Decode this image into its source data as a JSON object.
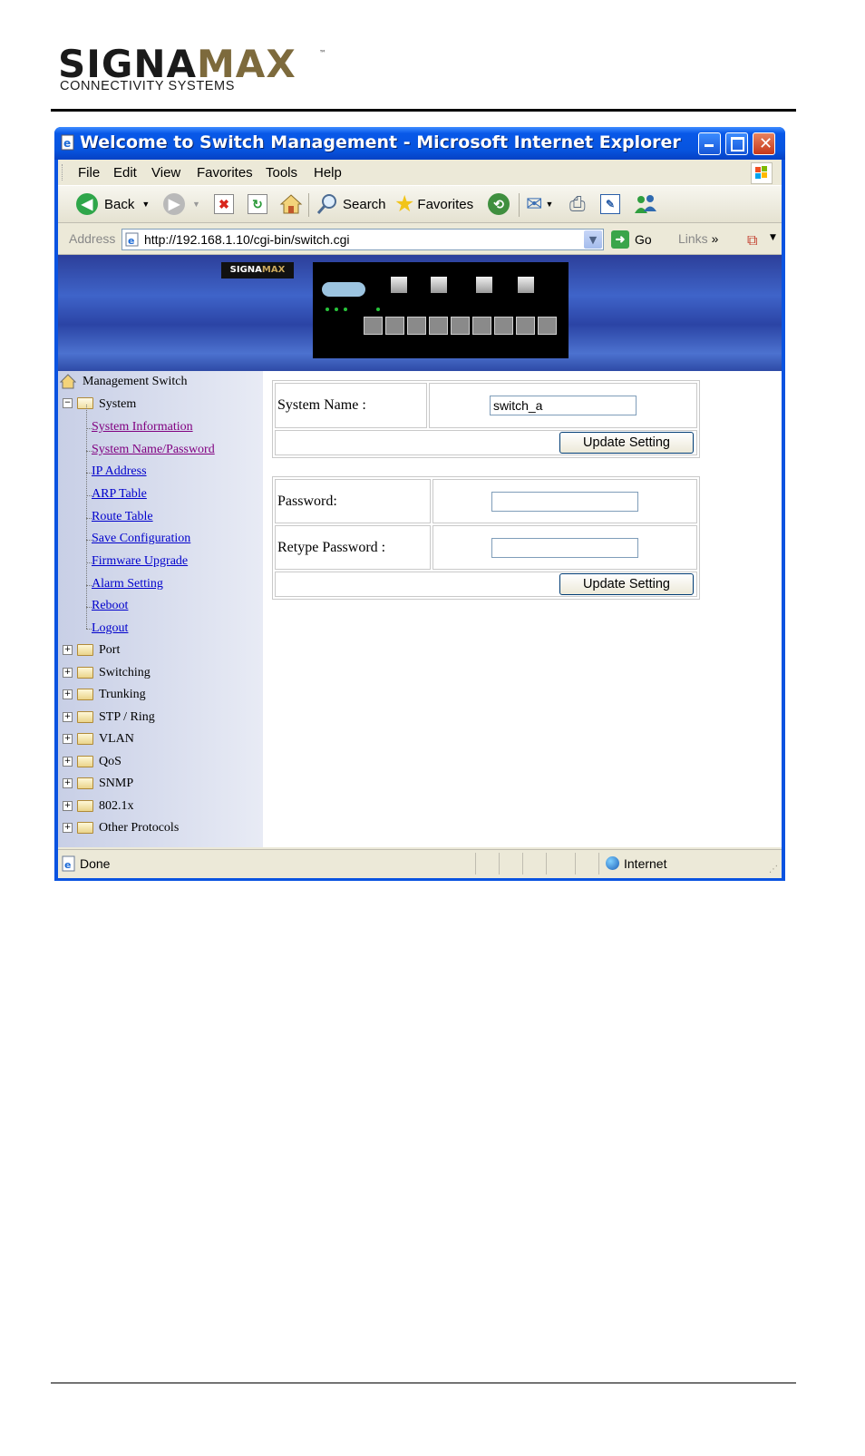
{
  "brand": {
    "name_left": "SIGNA",
    "name_right": "MAX",
    "trademark": "™",
    "tagline": "CONNECTIVITY SYSTEMS"
  },
  "window": {
    "title": "Welcome to Switch Management - Microsoft Internet Explorer"
  },
  "menu": [
    {
      "label": "File",
      "key": "F"
    },
    {
      "label": "Edit",
      "key": "E"
    },
    {
      "label": "View",
      "key": "V"
    },
    {
      "label": "Favorites",
      "key": "a"
    },
    {
      "label": "Tools",
      "key": "T"
    },
    {
      "label": "Help",
      "key": "H"
    }
  ],
  "toolbar": {
    "back": "Back",
    "search": "Search",
    "favorites": "Favorites"
  },
  "address": {
    "label": "Address",
    "url": "http://192.168.1.10/cgi-bin/switch.cgi",
    "go": "Go",
    "links": "Links",
    "more": "»"
  },
  "banner": {
    "logo_left": "SIGNA",
    "logo_right": "MAX"
  },
  "nav": {
    "root": "Management Switch",
    "system": "System",
    "system_links": [
      "System Information",
      "System Name/Password",
      "IP Address",
      "ARP Table",
      "Route Table",
      "Save Configuration",
      "Firmware Upgrade",
      "Alarm Setting",
      "Reboot",
      "Logout"
    ],
    "folders": [
      "Port",
      "Switching",
      "Trunking",
      "STP / Ring",
      "VLAN",
      "QoS",
      "SNMP",
      "802.1x",
      "Other Protocols"
    ]
  },
  "form1": {
    "label": "System Name :",
    "value": "switch_a",
    "button": "Update Setting"
  },
  "form2": {
    "password_label": "Password:",
    "retype_label": "Retype Password :",
    "password_value": "",
    "retype_value": "",
    "button": "Update Setting"
  },
  "status": {
    "left": "Done",
    "zone": "Internet"
  },
  "colors": {
    "xp_blue": "#0a53e1",
    "link": "#0000cc",
    "visited": "#800080"
  }
}
